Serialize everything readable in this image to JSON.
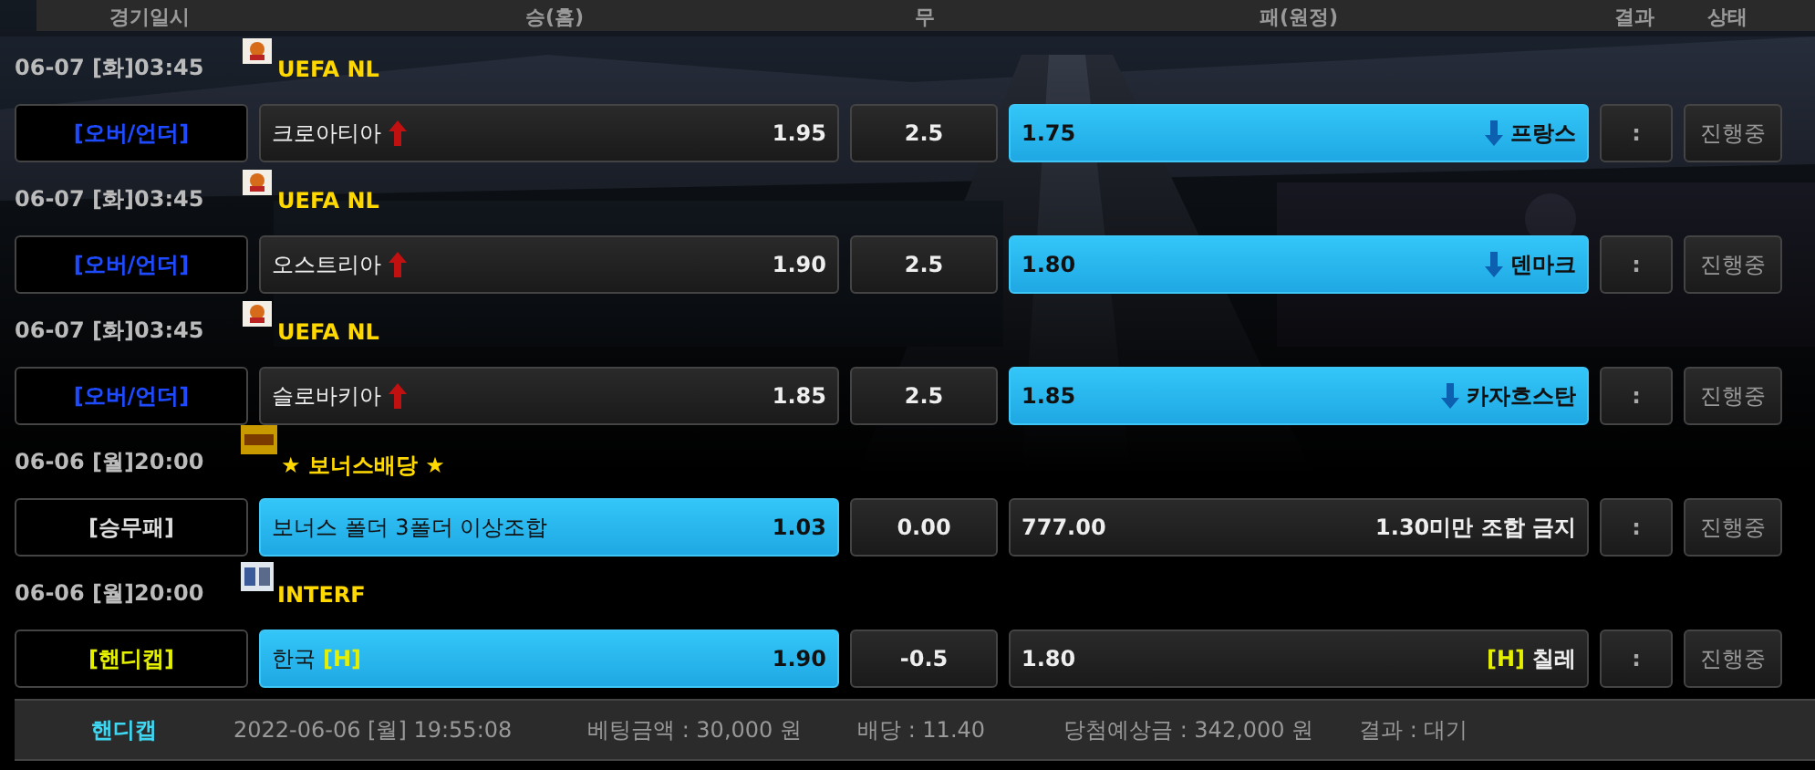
{
  "header": [
    "경기일시",
    "승(홈)",
    "무",
    "패(원정)",
    "결과",
    "상태"
  ],
  "games": [
    {
      "date": "06-07 [화]03:45",
      "league": {
        "kind": "flag",
        "name": "UEFA NL"
      },
      "type": {
        "label": "[오버/언더]",
        "color": "#1e4bff"
      },
      "home": {
        "name": "크로아티아",
        "kind": "up",
        "odds": "1.95",
        "selected": false
      },
      "draw": "2.5",
      "away": {
        "name": "프랑스",
        "kind": "down",
        "odds": "1.75",
        "selected": true
      },
      "score": ":",
      "status": "진행중"
    },
    {
      "date": "06-07 [화]03:45",
      "league": {
        "kind": "flag",
        "name": "UEFA NL"
      },
      "type": {
        "label": "[오버/언더]",
        "color": "#1e4bff"
      },
      "home": {
        "name": "오스트리아",
        "kind": "up",
        "odds": "1.90",
        "selected": false
      },
      "draw": "2.5",
      "away": {
        "name": "덴마크",
        "kind": "down",
        "odds": "1.80",
        "selected": true
      },
      "score": ":",
      "status": "진행중"
    },
    {
      "date": "06-07 [화]03:45",
      "league": {
        "kind": "flag",
        "name": "UEFA NL"
      },
      "type": {
        "label": "[오버/언더]",
        "color": "#1e4bff"
      },
      "home": {
        "name": "슬로바키아",
        "kind": "up",
        "odds": "1.85",
        "selected": false
      },
      "draw": "2.5",
      "away": {
        "name": "카자흐스탄",
        "kind": "down",
        "odds": "1.85",
        "selected": true
      },
      "score": ":",
      "status": "진행중"
    },
    {
      "date": "06-06 [월]20:00",
      "league": {
        "kind": "bonus",
        "name": "★ 보너스배당 ★"
      },
      "type": {
        "label": "[승무패]",
        "color": "#dddddd"
      },
      "home": {
        "name": "보너스 폴더 3폴더 이상조합",
        "odds": "1.03",
        "selected": true
      },
      "draw": "0.00",
      "away": {
        "name": "1.30미만 조합 금지",
        "odds": "777.00",
        "selected": false
      },
      "score": ":",
      "status": "진행중"
    },
    {
      "date": "06-06 [월]20:00",
      "league": {
        "kind": "team",
        "name": "INTERF"
      },
      "type": {
        "label": "[핸디캡]",
        "color": "#e5f000"
      },
      "home": {
        "name": "한국",
        "marker": "[H]",
        "odds": "1.90",
        "selected": true
      },
      "draw": "-0.5",
      "away": {
        "name": "칠레",
        "marker": "[H]",
        "odds": "1.80",
        "selected": false
      },
      "score": ":",
      "status": "진행중"
    }
  ],
  "summary": {
    "type": "핸디캡",
    "time": "2022-06-06 [월] 19:55:08",
    "amount": "베팅금액 : 30,000 원",
    "odds": "배당 : 11.40",
    "expected": "당첨예상금 : 342,000 원",
    "result": "결과 : 대기"
  }
}
